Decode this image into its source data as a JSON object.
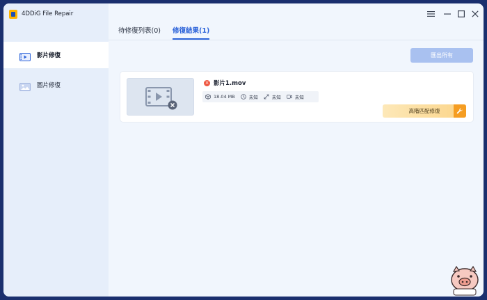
{
  "app": {
    "title": "4DDiG File Repair",
    "brand_color": "#ffb400",
    "accent_color": "#2c63d9"
  },
  "sidebar": {
    "items": [
      {
        "label": "影片修復",
        "icon": "video-icon",
        "active": true
      },
      {
        "label": "圖片修復",
        "icon": "image-icon",
        "active": false
      }
    ]
  },
  "tabs": [
    {
      "label": "待修復列表(0)",
      "active": false
    },
    {
      "label": "修復結果(1)",
      "active": true
    }
  ],
  "window_controls": [
    "settings-icon",
    "minimize-icon",
    "maximize-icon",
    "close-icon"
  ],
  "toolbar": {
    "export_all_label": "匯出所有"
  },
  "result": {
    "filename": "影片1.mov",
    "status": "error",
    "status_color": "#ee5740",
    "size": "18.04 MB",
    "duration": "未知",
    "resolution": "未知",
    "frame_info": "未知",
    "repair_button_label": "高階匹配修復"
  }
}
